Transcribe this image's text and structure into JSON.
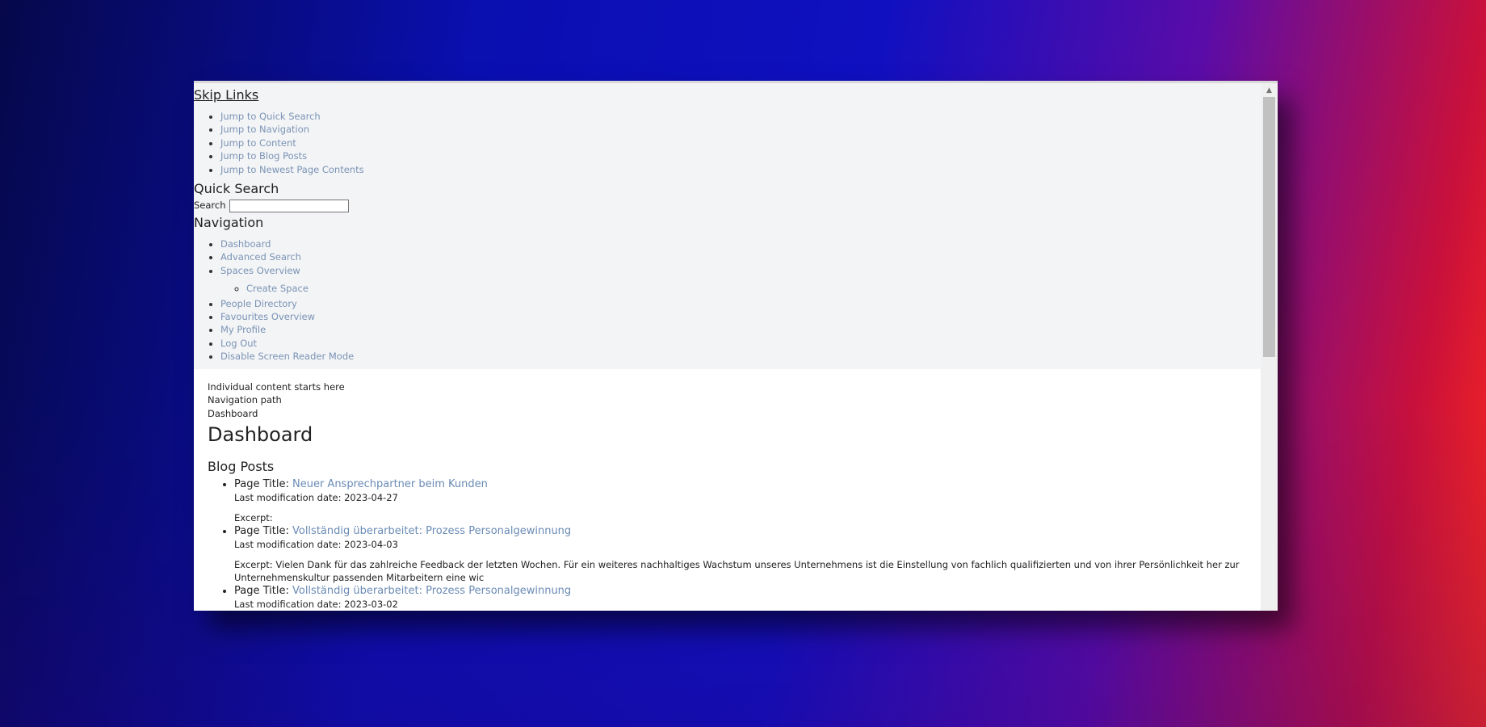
{
  "skip_links": {
    "heading": "Skip Links",
    "items": [
      "Jump to Quick Search",
      "Jump to Navigation",
      "Jump to Content",
      "Jump to Blog Posts",
      "Jump to Newest Page Contents"
    ]
  },
  "quick_search": {
    "heading": "Quick Search",
    "label": "Search",
    "value": ""
  },
  "navigation": {
    "heading": "Navigation",
    "items": [
      "Dashboard",
      "Advanced Search",
      "Spaces Overview"
    ],
    "subitems": [
      "Create Space"
    ],
    "items_after": [
      "People Directory",
      "Favourites Overview",
      "My Profile",
      "Log Out",
      "Disable Screen Reader Mode"
    ]
  },
  "content": {
    "start_text": "Individual content starts here",
    "nav_path_label": "Navigation path",
    "breadcrumb": "Dashboard",
    "page_title": "Dashboard",
    "blog_heading": "Blog Posts",
    "title_prefix": "Page Title:",
    "posts": [
      {
        "title": "Neuer Ansprechpartner beim Kunden",
        "modified": "Last modification date: 2023-04-27",
        "excerpt": "Excerpt:"
      },
      {
        "title": "Vollständig überarbeitet: Prozess Personalgewinnung",
        "modified": "Last modification date: 2023-04-03",
        "excerpt": "Excerpt: Vielen Dank für das zahlreiche Feedback der letzten Wochen. Für ein weiteres nachhaltiges Wachstum unseres Unternehmens ist die Einstellung von fachlich qualifizierten und von ihrer Persönlichkeit her zur Unternehmenskultur passenden Mitarbeitern eine wic"
      },
      {
        "title": "Vollständig überarbeitet: Prozess Personalgewinnung",
        "modified": "Last modification date: 2023-03-02",
        "excerpt": ""
      }
    ]
  }
}
